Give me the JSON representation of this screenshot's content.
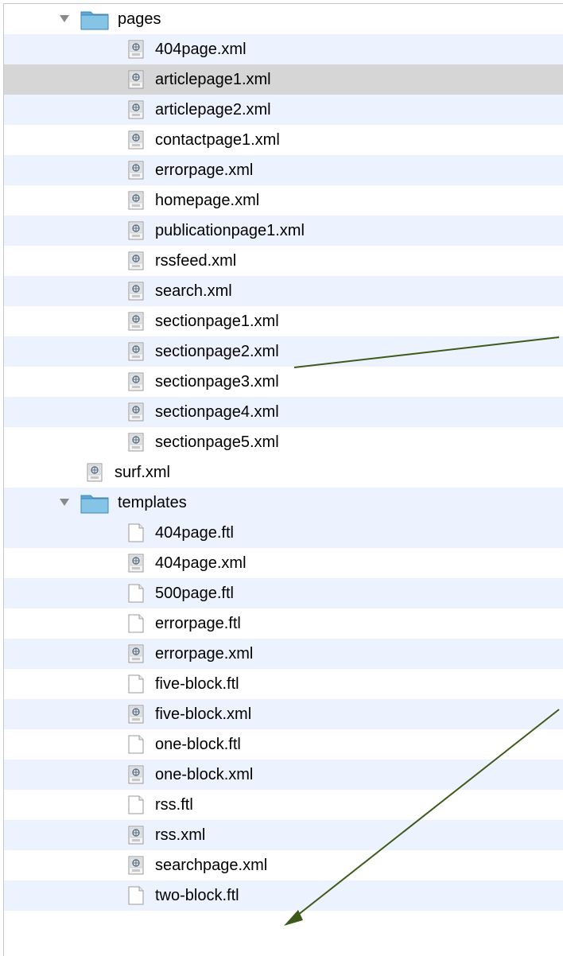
{
  "tree": {
    "pages_folder": {
      "label": "pages",
      "children": [
        "404page.xml",
        "articlepage1.xml",
        "articlepage2.xml",
        "contactpage1.xml",
        "errorpage.xml",
        "homepage.xml",
        "publicationpage1.xml",
        "rssfeed.xml",
        "search.xml",
        "sectionpage1.xml",
        "sectionpage2.xml",
        "sectionpage3.xml",
        "sectionpage4.xml",
        "sectionpage5.xml"
      ]
    },
    "root_file": "surf.xml",
    "templates_folder": {
      "label": "templates",
      "children": [
        "404page.ftl",
        "404page.xml",
        "500page.ftl",
        "errorpage.ftl",
        "errorpage.xml",
        "five-block.ftl",
        "five-block.xml",
        "one-block.ftl",
        "one-block.xml",
        "rss.ftl",
        "rss.xml",
        "searchpage.xml",
        "two-block.ftl"
      ]
    },
    "selected_item": "articlepage1.xml"
  },
  "colors": {
    "row_alt": "#edf3fe",
    "row_selected": "#d6d6d6",
    "folder": "#5aa9d6",
    "annotation_arrow": "#3d5a1a"
  }
}
